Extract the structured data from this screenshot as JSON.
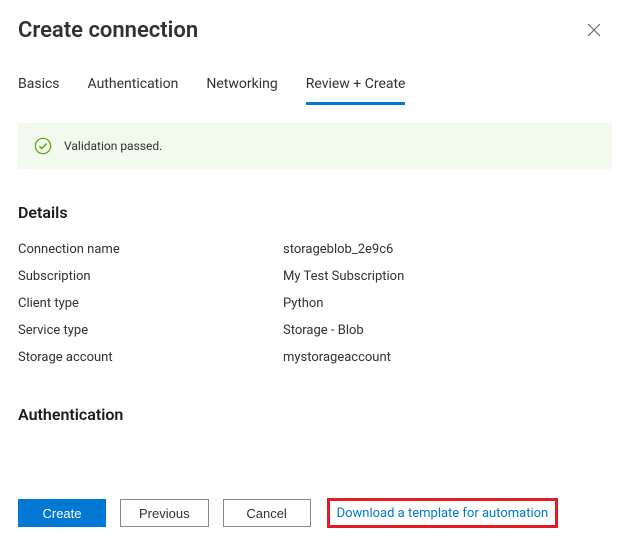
{
  "header": {
    "title": "Create connection"
  },
  "tabs": [
    {
      "label": "Basics",
      "active": false
    },
    {
      "label": "Authentication",
      "active": false
    },
    {
      "label": "Networking",
      "active": false
    },
    {
      "label": "Review + Create",
      "active": true
    }
  ],
  "validation": {
    "message": "Validation passed."
  },
  "sections": {
    "details_title": "Details",
    "details": [
      {
        "key": "Connection name",
        "val": "storageblob_2e9c6"
      },
      {
        "key": "Subscription",
        "val": "My Test Subscription"
      },
      {
        "key": "Client type",
        "val": "Python"
      },
      {
        "key": "Service type",
        "val": "Storage - Blob"
      },
      {
        "key": "Storage account",
        "val": "mystorageaccount"
      }
    ],
    "auth_title": "Authentication"
  },
  "footer": {
    "create": "Create",
    "previous": "Previous",
    "cancel": "Cancel",
    "download_link": "Download a template for automation"
  }
}
